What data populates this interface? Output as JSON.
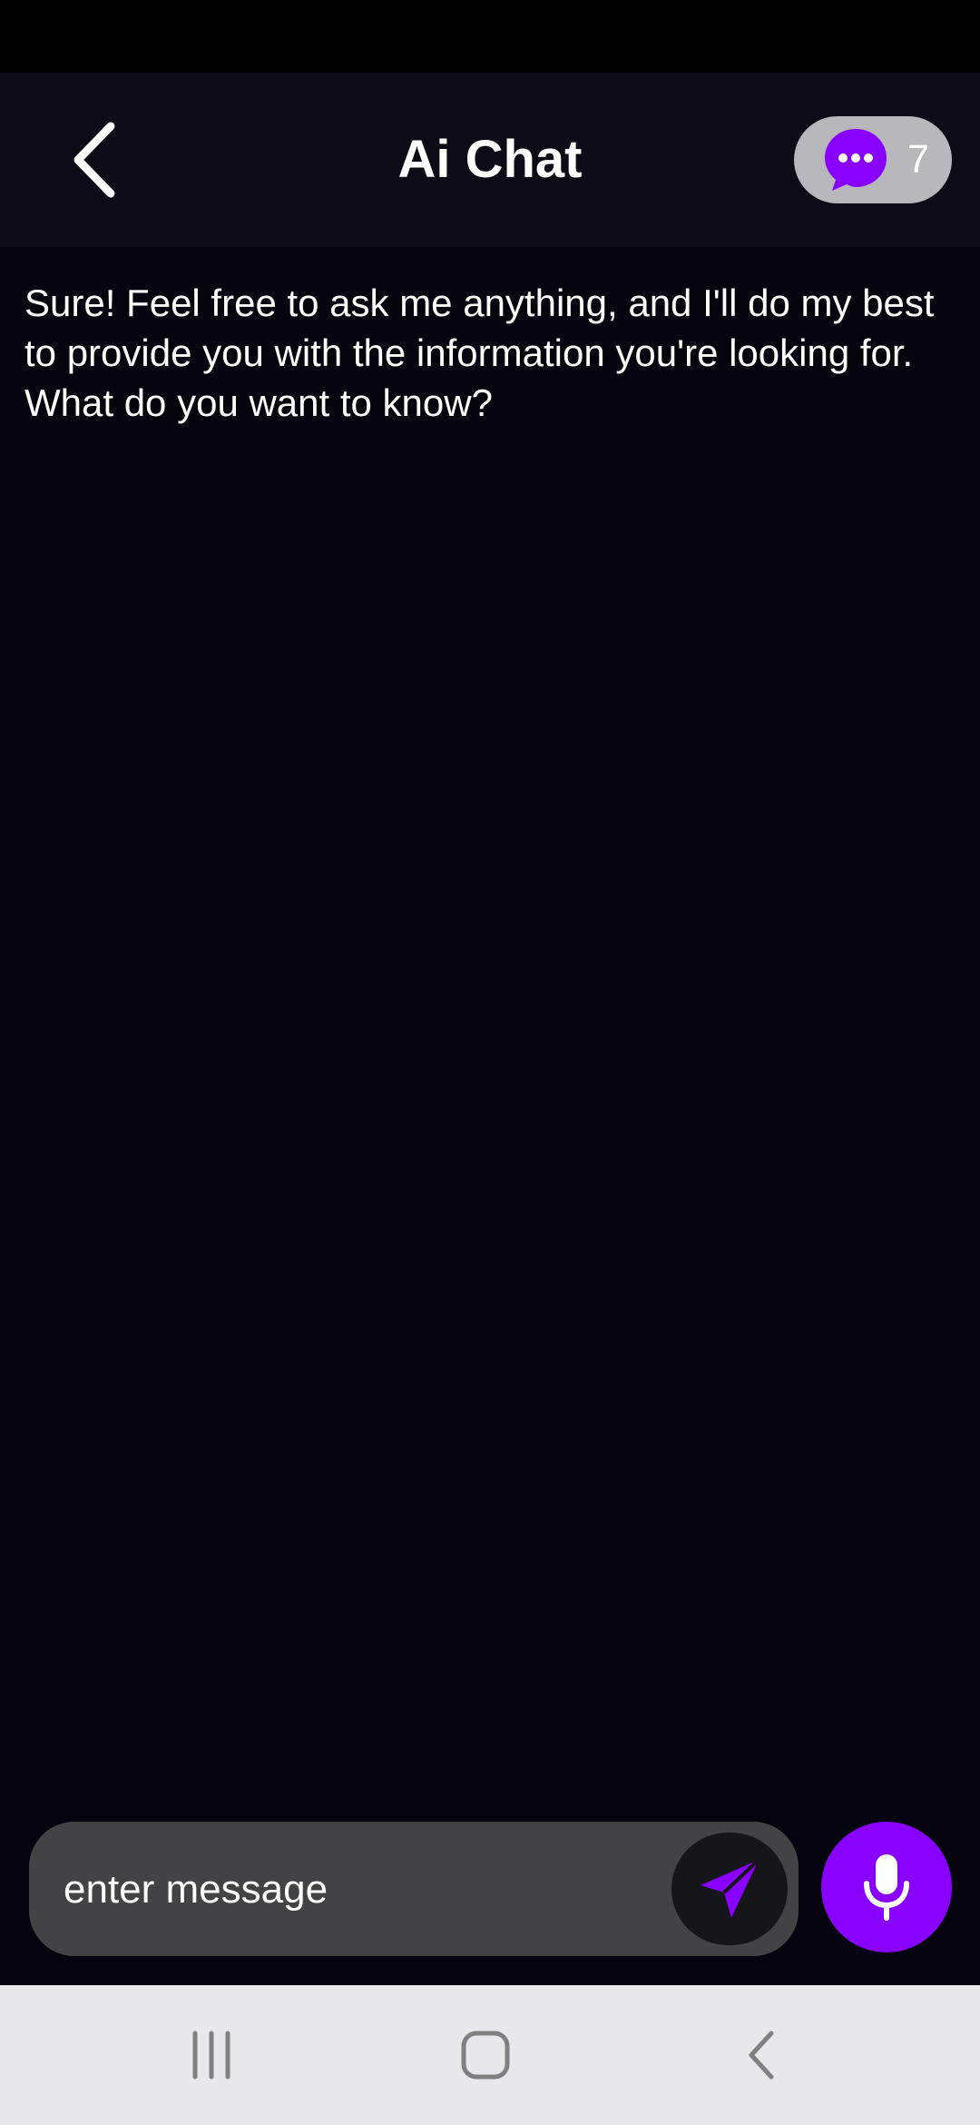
{
  "header": {
    "title": "Ai Chat",
    "credits_count": "7"
  },
  "messages": [
    {
      "role": "assistant",
      "text": "Sure! Feel free to ask me anything, and I'll do my best to provide you with the information you're looking for. What do you want to know?"
    }
  ],
  "composer": {
    "placeholder": "enter message",
    "value": ""
  },
  "icons": {
    "back": "chevron-left-icon",
    "credits": "chat-bubble-icon",
    "send": "send-icon",
    "mic": "microphone-icon",
    "nav_recents": "recents-icon",
    "nav_home": "home-icon",
    "nav_back": "back-icon"
  },
  "colors": {
    "accent": "#8a00ff",
    "background": "#04030e",
    "header_background": "#0c0b16",
    "pill_background": "#b8b7bb",
    "composer_background": "#434346",
    "nav_background": "#e8e8ec"
  }
}
